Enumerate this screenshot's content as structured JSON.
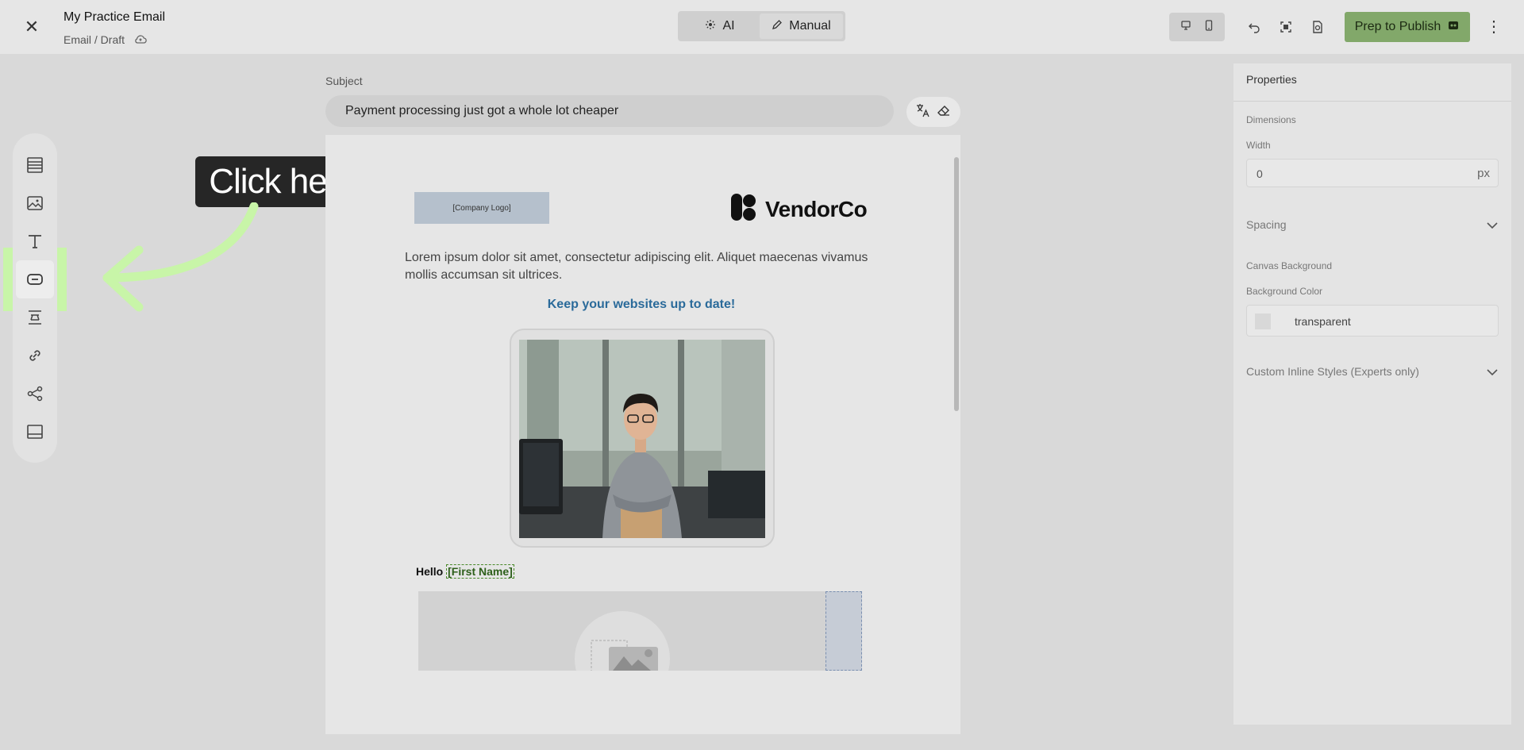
{
  "header": {
    "title": "My Practice Email",
    "breadcrumb": "Email / Draft",
    "mode_ai": "AI",
    "mode_manual": "Manual",
    "publish_label": "Prep to Publish"
  },
  "subject": {
    "label": "Subject",
    "value": "Payment processing just got a whole lot cheaper"
  },
  "toolbar": {
    "items": [
      "layout-icon",
      "image-icon",
      "text-icon",
      "button-icon",
      "spacer-icon",
      "link-icon",
      "share-icon",
      "footer-icon"
    ],
    "active": "button-icon"
  },
  "callout": {
    "text": "Click here",
    "color": "#c8f5a8"
  },
  "email": {
    "logo_placeholder": "[Company Logo]",
    "brand_name": "VendorCo",
    "body_text": "Lorem ipsum dolor sit amet, consectetur adipiscing elit. Aliquet maecenas vivamus mollis accumsan sit ultrices.",
    "headline": "Keep your websites up to date!",
    "greeting": "Hello",
    "merge_tag": "[First Name]"
  },
  "properties": {
    "title": "Properties",
    "dimensions": "Dimensions",
    "width_label": "Width",
    "width_value": "0",
    "width_unit": "px",
    "spacing": "Spacing",
    "canvas_background": "Canvas Background",
    "background_color_label": "Background Color",
    "background_color_value": "transparent",
    "custom_styles": "Custom Inline Styles (Experts only)"
  },
  "colors": {
    "publish": "#82a86a",
    "headline": "#2a6a9a",
    "highlight": "#c8f5a8"
  }
}
